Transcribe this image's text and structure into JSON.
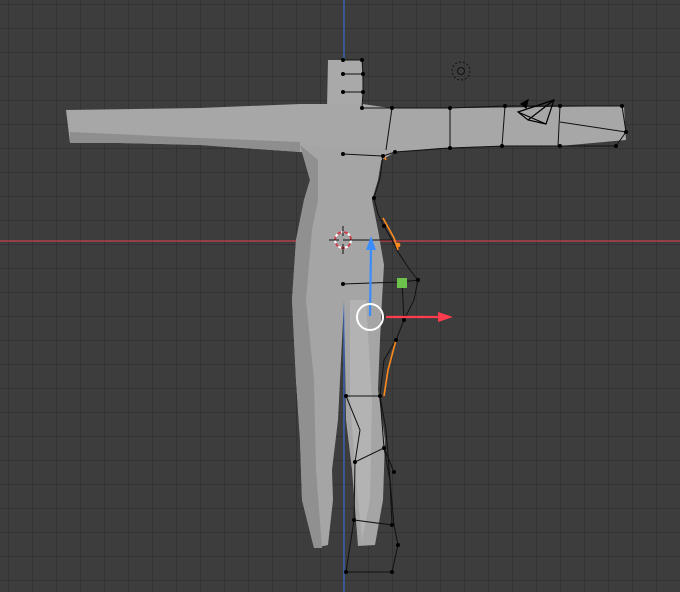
{
  "viewport": {
    "grid_color": "#333333",
    "background_color": "#3d3d3d"
  },
  "axes": {
    "x_axis_color": "#c8414b",
    "y_axis_color": "#3f6fcf"
  },
  "mesh": {
    "body_fill": "#a7a7a7",
    "body_shade": "#8f8f8f",
    "wire_color": "#111111",
    "selected_edge_color": "#ff8a1e"
  },
  "gizmo": {
    "move_x_color": "#ff3b4e",
    "move_y_color": "#3b8cff",
    "plane_handle_color": "#6cc24a",
    "rotate_ring_color": "#ffffff"
  },
  "overlays": {
    "cursor_icon": "3d-cursor-icon",
    "light_icon": "light-icon",
    "camera_icon": "camera-icon"
  }
}
